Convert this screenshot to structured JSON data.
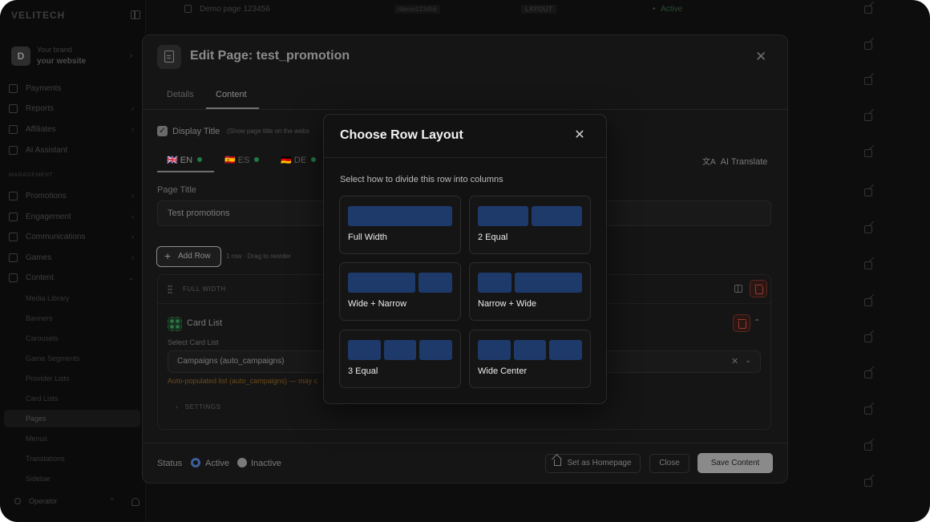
{
  "sidebar": {
    "logo": "VELITECH",
    "brand_label": "Your brand",
    "brand_site": "your website",
    "brand_initial": "D",
    "items_top": [
      {
        "label": "Payments",
        "chevron": false
      },
      {
        "label": "Reports",
        "chevron": true
      },
      {
        "label": "Affiliates",
        "chevron": true
      },
      {
        "label": "AI Assistant",
        "chevron": false
      }
    ],
    "section_label": "MANAGEMENT",
    "items_management": [
      {
        "label": "Promotions",
        "chevron": true
      },
      {
        "label": "Engagement",
        "chevron": true
      },
      {
        "label": "Communications",
        "chevron": true
      },
      {
        "label": "Games",
        "chevron": true
      },
      {
        "label": "Content",
        "chevron": true
      }
    ],
    "content_subitems": [
      "Media Library",
      "Banners",
      "Carousels",
      "Game Segments",
      "Provider Lists",
      "Card Lists",
      "Pages",
      "Menus",
      "Translations",
      "Sidebar"
    ],
    "active_subitem": "Pages",
    "operator": "Operator"
  },
  "background_list": {
    "first_row": {
      "name": "Demo page 123456",
      "slug": "/demo123456",
      "type": "LAYOUT",
      "status": "Active"
    }
  },
  "edit_panel": {
    "title": "Edit Page: test_promotion",
    "tabs": [
      "Details",
      "Content"
    ],
    "active_tab": "Content",
    "display_title_label": "Display Title",
    "display_title_hint": "(Show page title on the webs",
    "languages": [
      {
        "code": "EN",
        "flag": "🇬🇧"
      },
      {
        "code": "ES",
        "flag": "🇪🇸"
      },
      {
        "code": "DE",
        "flag": "🇩🇪"
      }
    ],
    "ai_translate": "AI Translate",
    "page_title_label": "Page Title",
    "page_title_value": "Test promotions",
    "add_row": "Add Row",
    "row_count": "1 row · Drag to reorder",
    "row_layout_label": "FULL WIDTH",
    "card_list_title": "Card List",
    "select_card_list_label": "Select Card List",
    "selected_card_list": "Campaigns (auto_campaigns)",
    "auto_note": "Auto-populated list (auto_campaigns) — may c",
    "settings_label": "SETTINGS",
    "status_label": "Status",
    "status_options": [
      "Active",
      "Inactive"
    ],
    "status_selected": "Active",
    "set_homepage": "Set as Homepage",
    "close": "Close",
    "save": "Save Content"
  },
  "modal": {
    "title": "Choose Row Layout",
    "subtitle": "Select how to divide this row into columns",
    "options": [
      {
        "label": "Full Width",
        "cols": [
          1
        ]
      },
      {
        "label": "2 Equal",
        "cols": [
          1,
          1
        ]
      },
      {
        "label": "Wide + Narrow",
        "cols": [
          2,
          1
        ]
      },
      {
        "label": "Narrow + Wide",
        "cols": [
          1,
          2
        ]
      },
      {
        "label": "3 Equal",
        "cols": [
          1,
          1,
          1
        ]
      },
      {
        "label": "Wide Center",
        "cols": [
          1,
          1,
          1
        ]
      }
    ],
    "block_color": "#1e3a6b"
  },
  "colors": {
    "app_bg": "#0d0d0d",
    "modal_bg": "#121212",
    "accent_blue": "#1e3a6b",
    "status_green": "#1f7a44",
    "danger": "#9b3b2e"
  }
}
